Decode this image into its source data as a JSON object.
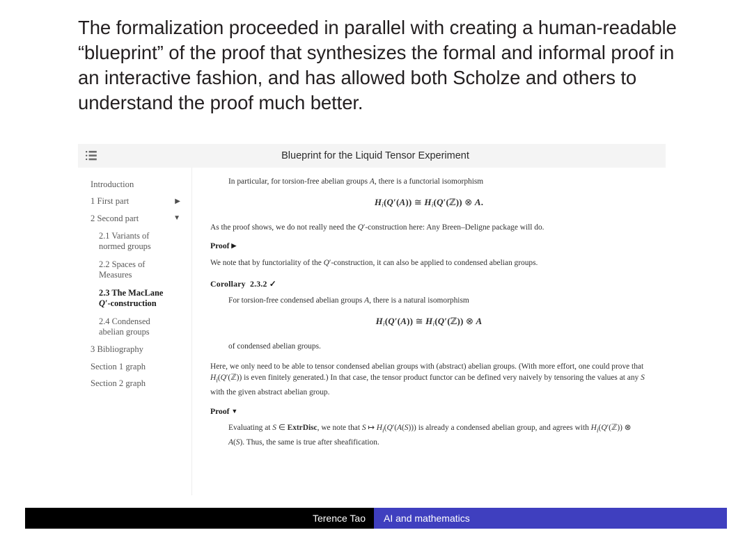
{
  "slide": {
    "headline": "The formalization proceeded in parallel with creating a human-readable “blueprint” of the proof that synthesizes the formal and informal proof in an interactive fashion, and has allowed both Scholze and others to understand the proof much better.",
    "footer": {
      "author": "Terence Tao",
      "talk_title": "AI and mathematics",
      "left_color": "#000000",
      "right_color": "#3f3fbf"
    }
  },
  "blueprint": {
    "header": {
      "title": "Blueprint for the Liquid Tensor Experiment",
      "toc_icon": "list-toc-icon",
      "background": "#f4f4f4"
    },
    "sidebar": {
      "items": [
        {
          "label": "Introduction",
          "level": 1,
          "caret": "",
          "current": false
        },
        {
          "label": "1 First part",
          "level": 1,
          "caret": "▶",
          "current": false
        },
        {
          "label": "2 Second part",
          "level": 1,
          "caret": "▼",
          "current": false
        },
        {
          "label": "2.1 Variants of normed groups",
          "level": 2,
          "caret": "",
          "current": false
        },
        {
          "label": "2.2 Spaces of Measures",
          "level": 2,
          "caret": "",
          "current": false
        },
        {
          "label": "2.3 The MacLane Q′-construction",
          "level": 2,
          "caret": "",
          "current": true
        },
        {
          "label": "2.4 Condensed abelian groups",
          "level": 2,
          "caret": "",
          "current": false
        },
        {
          "label": "3 Bibliography",
          "level": 1,
          "caret": "",
          "current": false
        },
        {
          "label": "Section 1 graph",
          "level": 1,
          "caret": "",
          "current": false
        },
        {
          "label": "Section 2 graph",
          "level": 1,
          "caret": "",
          "current": false
        }
      ]
    },
    "content": {
      "p1": "In particular, for torsion-free abelian groups A, there is a functorial isomorphism",
      "eq1": "H_i(Q′(A)) ≅ H_i(Q′(ℤ)) ⊗ A.",
      "p2": "As the proof shows, we do not really need the Q′-construction here: Any Breen–Deligne package will do.",
      "proof1_label": "Proof",
      "proof1_caret": "▶",
      "p3": "We note that by functoriality of the Q′-construction, it can also be applied to condensed abelian groups.",
      "corollary_label": "Corollary",
      "corollary_number": "2.3.2",
      "corollary_check": "✓",
      "p4": "For torsion-free condensed abelian groups A, there is a natural isomorphism",
      "eq2": "H_i(Q′(A)) ≅ H_i(Q′(ℤ)) ⊗ A",
      "p5": "of condensed abelian groups.",
      "p6": "Here, we only need to be able to tensor condensed abelian groups with (abstract) abelian groups. (With more effort, one could prove that H_i(Q′(ℤ)) is even finitely generated.) In that case, the tensor product functor can be defined very naively by tensoring the values at any S with the given abstract abelian group.",
      "proof2_label": "Proof",
      "proof2_caret": "▼",
      "p7": "Evaluating at S ∈ ExtrDisc, we note that S ↦ H_i(Q′(A(S))) is already a condensed abelian group, and agrees with H_i(Q′(ℤ)) ⊗ A(S). Thus, the same is true after sheafification."
    }
  }
}
